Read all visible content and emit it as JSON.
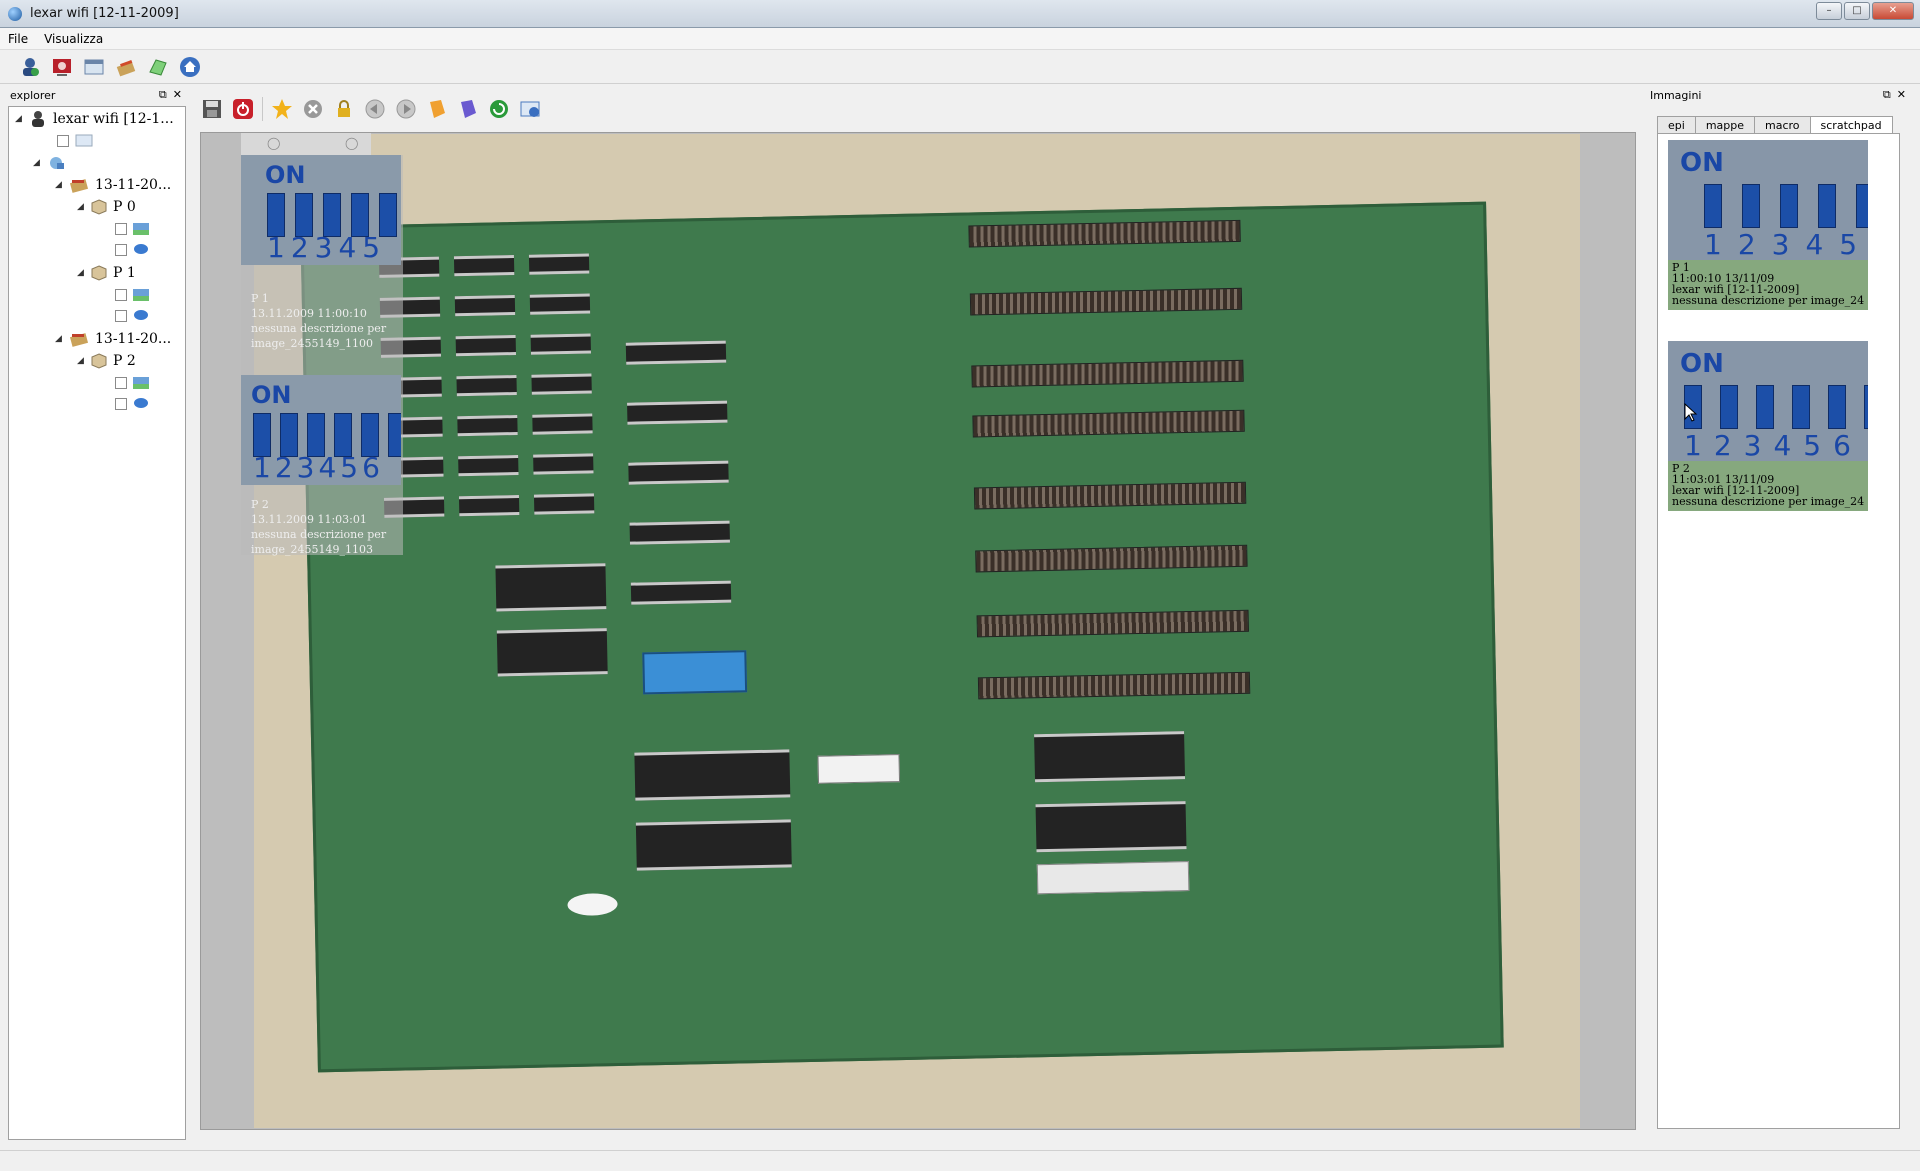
{
  "window": {
    "title": "lexar wifi [12-11-2009]"
  },
  "menu": {
    "items": [
      "File",
      "Visualizza"
    ]
  },
  "explorer": {
    "title": "explorer",
    "tree": [
      {
        "label": "lexar wifi [12-1..."
      },
      {
        "label": "13-11-20..."
      },
      {
        "label": "P 0"
      },
      {
        "label": "P 1"
      },
      {
        "label": "13-11-20..."
      },
      {
        "label": "P 2"
      }
    ]
  },
  "viewer": {
    "overlay": [
      {
        "title": "P 1",
        "date": "13.11.2009 11:00:10",
        "desc": "nessuna descrizione per",
        "file": "image_2455149_1100"
      },
      {
        "title": "P 2",
        "date": "13.11.2009 11:03:01",
        "desc": "nessuna descrizione per",
        "file": "image_2455149_1103"
      }
    ]
  },
  "immagini": {
    "title": "Immagini",
    "tabs": [
      "epi",
      "mappe",
      "macro",
      "scratchpad"
    ],
    "active_tab": "scratchpad",
    "cards": [
      {
        "name": "P 1",
        "time": "11:00:10 13/11/09",
        "source": "lexar wifi [12-11-2009]",
        "desc": "nessuna descrizione per image_24"
      },
      {
        "name": "P 2",
        "time": "11:03:01 13/11/09",
        "source": "lexar wifi [12-11-2009]",
        "desc": "nessuna descrizione per image_24"
      }
    ]
  },
  "dip": {
    "on_label": "ON",
    "numbers": "12345",
    "numbers6": "123456"
  },
  "colors": {
    "card_caption": "#86a87e",
    "pcb": "#3f7a4d",
    "dip_blue": "#1c4fa8"
  },
  "icons": {
    "main_toolbar": [
      "user-icon",
      "camera-icon",
      "window-icon",
      "edit-icon",
      "map-icon",
      "home-icon"
    ],
    "viewer_toolbar": [
      "save-icon",
      "power-icon",
      "star-icon",
      "cancel-icon",
      "lock-icon",
      "back-icon",
      "forward-icon",
      "tag-icon",
      "book-icon",
      "refresh-icon",
      "export-icon"
    ]
  }
}
